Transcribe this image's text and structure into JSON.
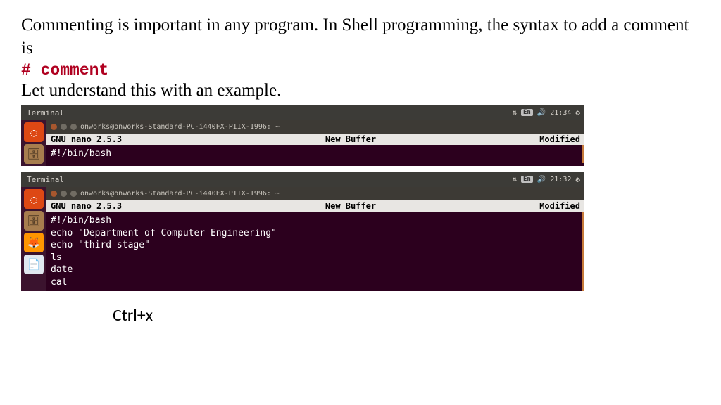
{
  "heading": "Commenting is important in any program. In Shell programming, the syntax to add a comment is",
  "syntax": "#  comment",
  "subheading": "Let understand this with an example.",
  "shortcut": "Ctrl+x",
  "terminal1": {
    "titlebar": "Terminal",
    "time": "21:34",
    "lang": "En",
    "inner_title": "onworks@onworks-Standard-PC-i440FX-PIIX-1996: ~",
    "nano_version": "GNU nano 2.5.3",
    "buffer": "New Buffer",
    "status": "Modified",
    "code": "#!/bin/bash"
  },
  "terminal2": {
    "titlebar": "Terminal",
    "time": "21:32",
    "lang": "En",
    "inner_title": "onworks@onworks-Standard-PC-i440FX-PIIX-1996: ~",
    "nano_version": "GNU nano 2.5.3",
    "buffer": "New Buffer",
    "status": "Modified",
    "code": "#!/bin/bash\necho \"Department of Computer Engineering\"\necho \"third stage\"\nls\ndate\ncal"
  }
}
